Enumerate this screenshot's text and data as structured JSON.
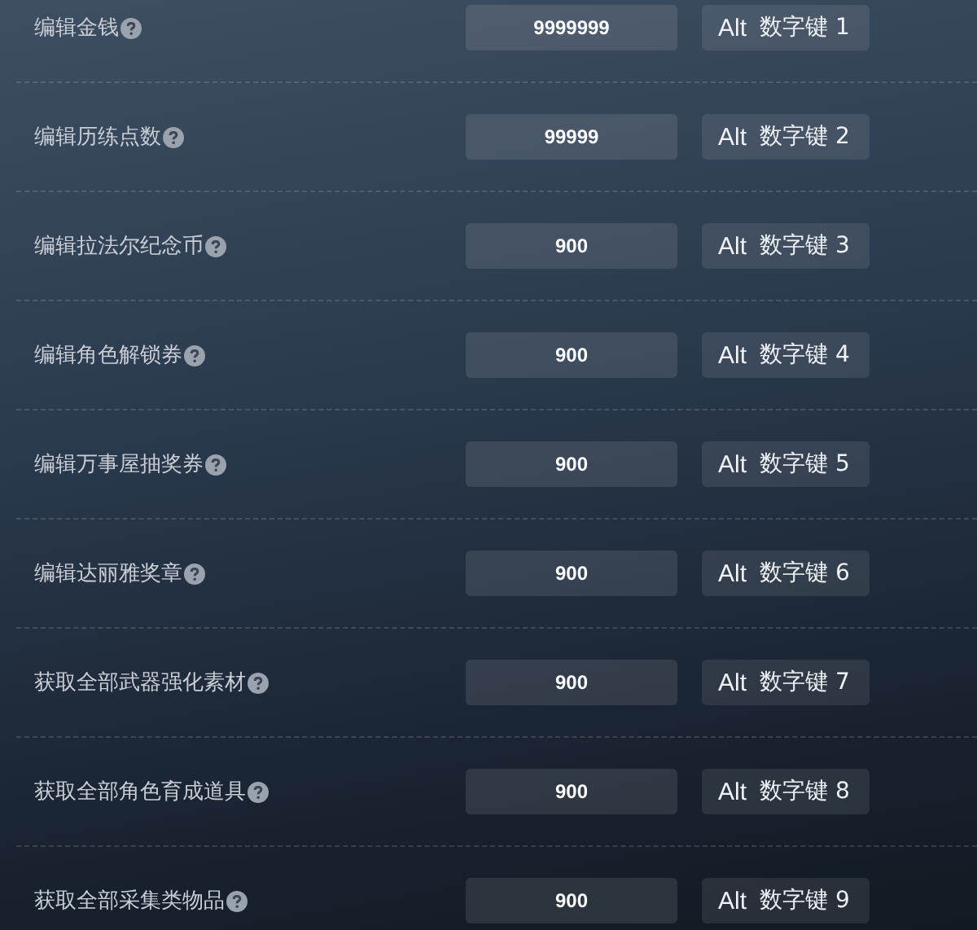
{
  "rows": [
    {
      "label": "编辑金钱",
      "value": "9999999",
      "modifier": "Alt",
      "key": "数字键 1"
    },
    {
      "label": "编辑历练点数",
      "value": "99999",
      "modifier": "Alt",
      "key": "数字键 2"
    },
    {
      "label": "编辑拉法尔纪念币",
      "value": "900",
      "modifier": "Alt",
      "key": "数字键 3"
    },
    {
      "label": "编辑角色解锁券",
      "value": "900",
      "modifier": "Alt",
      "key": "数字键 4"
    },
    {
      "label": "编辑万事屋抽奖券",
      "value": "900",
      "modifier": "Alt",
      "key": "数字键 5"
    },
    {
      "label": "编辑达丽雅奖章",
      "value": "900",
      "modifier": "Alt",
      "key": "数字键 6"
    },
    {
      "label": "获取全部武器强化素材",
      "value": "900",
      "modifier": "Alt",
      "key": "数字键 7"
    },
    {
      "label": "获取全部角色育成道具",
      "value": "900",
      "modifier": "Alt",
      "key": "数字键 8"
    },
    {
      "label": "获取全部采集类物品",
      "value": "900",
      "modifier": "Alt",
      "key": "数字键 9"
    }
  ]
}
